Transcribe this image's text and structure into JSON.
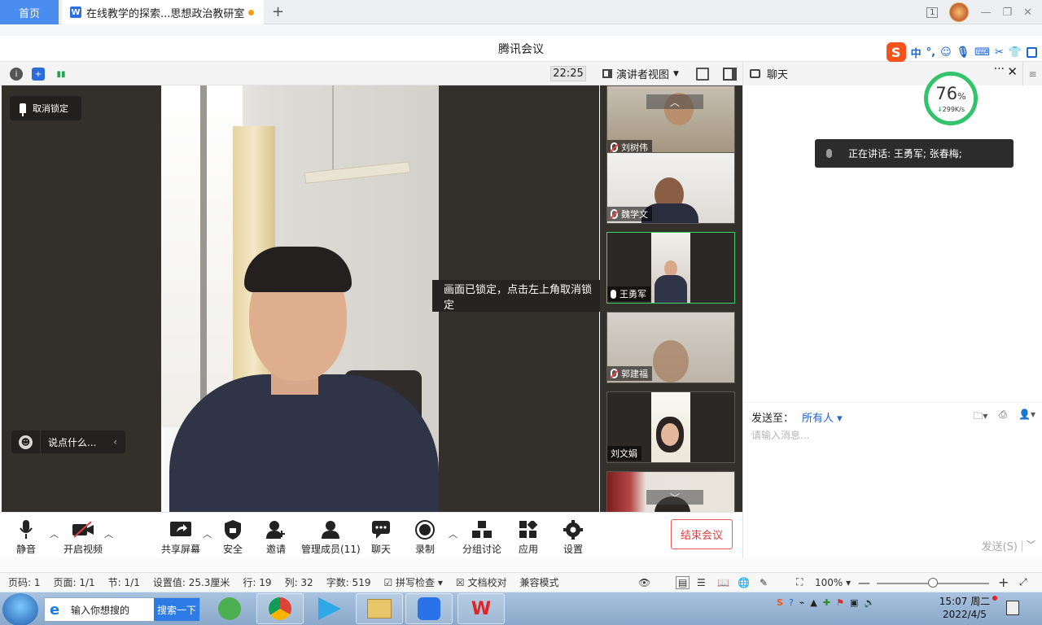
{
  "wps": {
    "home_tab": "首页",
    "doc_tab": "在线教学的探索...思想政治教研室",
    "new_tab": "+",
    "window_badge": "1"
  },
  "meeting": {
    "title": "腾讯会议",
    "timer": "22:25",
    "view_mode": "演讲者视图",
    "unpin_label": "取消锁定",
    "say_placeholder": "说点什么...",
    "lock_tip": "画面已锁定，点击左上角取消锁定",
    "participants": [
      {
        "name": "刘树伟",
        "muted": true
      },
      {
        "name": "魏学文",
        "muted": true
      },
      {
        "name": "王勇军",
        "muted": false
      },
      {
        "name": "郭建福",
        "muted": true
      },
      {
        "name": "刘文娟",
        "muted": null
      }
    ],
    "toolbar": {
      "mute": "静音",
      "video": "开启视频",
      "share": "共享屏幕",
      "security": "安全",
      "invite": "邀请",
      "members": "管理成员(11)",
      "chat": "聊天",
      "record": "录制",
      "breakout": "分组讨论",
      "apps": "应用",
      "settings": "设置",
      "end": "结束会议"
    }
  },
  "ime": {
    "lang": "中"
  },
  "chat": {
    "title": "聊天",
    "network_pct": "76",
    "network_unit": "%",
    "network_speed": "299K/s",
    "speaking": "正在讲话: 王勇军; 张春梅;",
    "send_to_label": "发送至：",
    "send_to_value": "所有人",
    "input_placeholder": "请输入消息...",
    "send_button": "发送(S)"
  },
  "statusbar": {
    "page_code": "页码: 1",
    "page": "页面: 1/1",
    "section": "节: 1/1",
    "setting": "设置值: 25.3厘米",
    "row": "行: 19",
    "col": "列: 32",
    "words": "字数: 519",
    "spell": "拼写检查",
    "proof": "文档校对",
    "compat": "兼容模式",
    "zoom": "100%"
  },
  "taskbar": {
    "search_placeholder": "输入你想搜的",
    "search_button": "搜索一下",
    "time": "15:07 周二",
    "date": "2022/4/5"
  },
  "colors": {
    "accent_blue": "#4a8cf0",
    "end_red": "#e04040",
    "active_green": "#3cd36b",
    "gauge_green": "#33c46b"
  }
}
